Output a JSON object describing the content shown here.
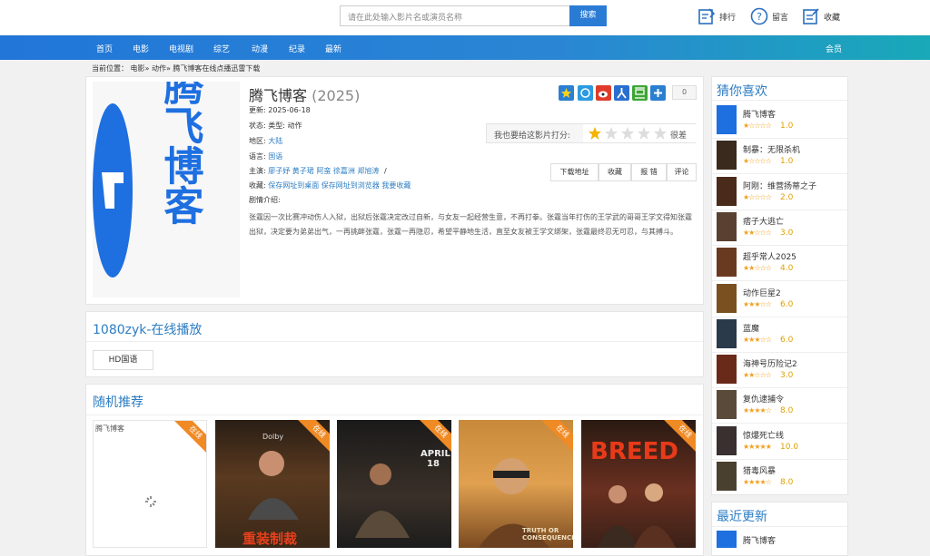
{
  "search": {
    "placeholder": "请在此处输入影片名或演员名称",
    "button": "搜索"
  },
  "tools": {
    "rank": "排行",
    "message": "留言",
    "favorite": "收藏"
  },
  "nav": {
    "items": [
      "首页",
      "电影",
      "电视剧",
      "综艺",
      "动漫",
      "纪录",
      "最新"
    ],
    "member": "会员"
  },
  "breadcrumb": {
    "prefix": "当前位置：",
    "path": "电影» 动作» 腾飞博客在线点播迅雷下载"
  },
  "poster": {
    "text": "腾飞博客"
  },
  "movie": {
    "title": "腾飞博客",
    "year": "(2025)",
    "update_label": "更新:",
    "update": "2025-06-18",
    "status_label": "状态:",
    "type_label": "类型:",
    "type": "动作",
    "region_label": "地区:",
    "region": "大陆",
    "lang_label": "语言:",
    "lang": "国语",
    "cast_label": "主演:",
    "cast": [
      "廖子妤",
      "黄子珺",
      "阿蛮",
      "徐嘉洲",
      "郑旭涛"
    ],
    "cast_sep": "/",
    "fav_label": "收藏:",
    "fav_links": [
      "保存网址到桌面",
      "保存网址到浏览器",
      "我要收藏"
    ],
    "desc_label": "剧情介绍:",
    "desc": "张霆因一次比赛冲动伤人入狱，出狱后张霆决定改过自新，与女友一起经营生意，不再打拳。张霆当年打伤的王学武的哥哥王学文得知张霆出狱，决定要为弟弟出气，一再挑衅张霆，张霆一再隐忍，希望平静地生活，直至女友被王学文绑架，张霆最终忍无可忍，与其搏斗。"
  },
  "share_count": "0",
  "rating": {
    "prompt": "我也要给这影片打分:",
    "stars": 1,
    "label": "很差"
  },
  "actions": [
    "下载地址",
    "收藏",
    "报 错",
    "评论"
  ],
  "play": {
    "title": "1080zyk-在线播放",
    "episode": "HD国语"
  },
  "random": {
    "title": "随机推荐",
    "first_alt": "腾飞博客",
    "ribbon": "在线",
    "card2_brand": "Dolby",
    "card2_title": "重装制裁",
    "card3_date": "APRIL 18",
    "card4_title": "TRUTH OR CONSEQUENCES",
    "card5_title": "BREED"
  },
  "sidebar": {
    "title": "猜你喜欢",
    "items": [
      {
        "name": "腾飞博客",
        "score": "1.0",
        "stars": 1
      },
      {
        "name": "制暴：无限杀机",
        "score": "1.0",
        "stars": 1
      },
      {
        "name": "阿刚：维营扬蒂之子",
        "score": "2.0",
        "stars": 1
      },
      {
        "name": "痞子大逃亡",
        "score": "3.0",
        "stars": 2
      },
      {
        "name": "超乎常人2025",
        "score": "4.0",
        "stars": 2
      },
      {
        "name": "动作巨星2",
        "score": "6.0",
        "stars": 3
      },
      {
        "name": "蓝魔",
        "score": "6.0",
        "stars": 3
      },
      {
        "name": "海神号历险记2",
        "score": "3.0",
        "stars": 2
      },
      {
        "name": "复仇逮捕令",
        "score": "8.0",
        "stars": 4
      },
      {
        "name": "惊爆死亡线",
        "score": "10.0",
        "stars": 5
      },
      {
        "name": "猎毒风暴",
        "score": "8.0",
        "stars": 4
      }
    ],
    "recent_title": "最近更新",
    "recent_first": "腾飞博客"
  },
  "colors": {
    "accent": "#2d7dc3",
    "nav_start": "#2176d8",
    "nav_end": "#19a9b8",
    "ribbon": "#f08a24",
    "star": "#f0a020"
  }
}
